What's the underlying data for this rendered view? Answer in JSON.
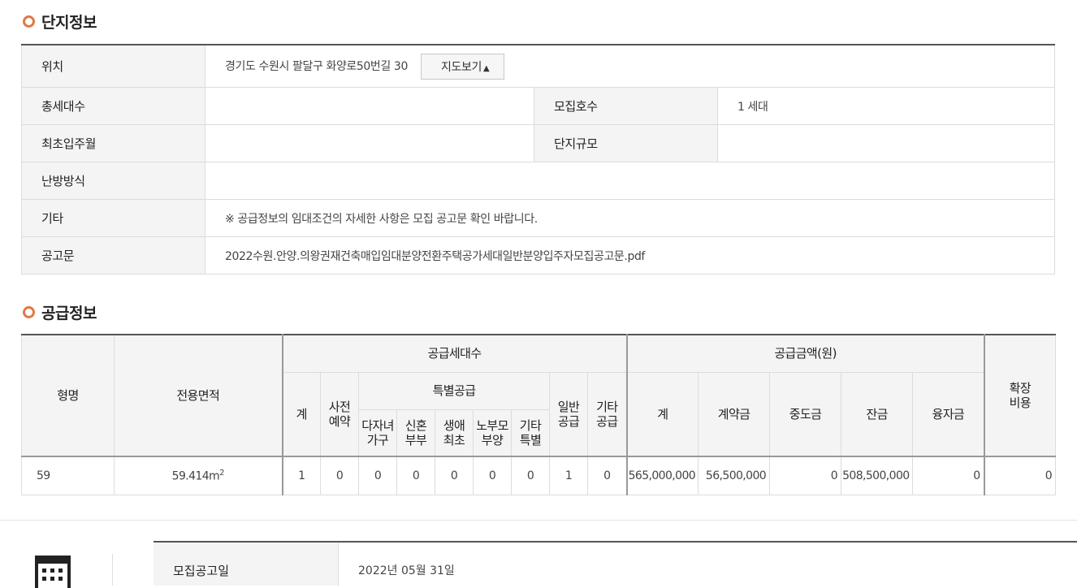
{
  "complex_section": {
    "title": "단지정보",
    "location_label": "위치",
    "location_value": "경기도 수원시 팔달구 화양로50번길 30",
    "map_button": "지도보기",
    "total_households_label": "총세대수",
    "total_households_value": "",
    "recruit_units_label": "모집호수",
    "recruit_units_value": "1 세대",
    "first_movein_label": "최초입주월",
    "first_movein_value": "",
    "complex_scale_label": "단지규모",
    "complex_scale_value": "",
    "heating_label": "난방방식",
    "heating_value": "",
    "other_label": "기타",
    "other_value": "※ 공급정보의 임대조건의 자세한 사항은 모집 공고문 확인 바랍니다.",
    "notice_label": "공고문",
    "notice_file": "2022수원.안양.의왕권재건축매입임대분양전환주택공가세대일반분양입주자모집공고문.pdf"
  },
  "supply_section": {
    "title": "공급정보",
    "headers": {
      "type": "형명",
      "area": "전용면적",
      "supply_units": "공급세대수",
      "total": "계",
      "pre_reservation_1": "사전",
      "pre_reservation_2": "예약",
      "special": "특별공급",
      "multi_child_1": "다자녀",
      "multi_child_2": "가구",
      "newlywed_1": "신혼",
      "newlywed_2": "부부",
      "first_life_1": "생애",
      "first_life_2": "최초",
      "elderly_1": "노부모",
      "elderly_2": "부양",
      "other_special_1": "기타",
      "other_special_2": "특별",
      "general_1": "일반",
      "general_2": "공급",
      "other_supply_1": "기타",
      "other_supply_2": "공급",
      "supply_price": "공급금액(원)",
      "price_total": "계",
      "contract": "계약금",
      "middle": "중도금",
      "balance": "잔금",
      "loan": "융자금",
      "extension_1": "확장",
      "extension_2": "비용"
    },
    "row": {
      "type": "59",
      "area": "59.414m",
      "area_unit_sup": "2",
      "total": "1",
      "pre_reservation": "0",
      "multi_child": "0",
      "newlywed": "0",
      "first_life": "0",
      "elderly": "0",
      "other_special": "0",
      "general": "1",
      "other_supply": "0",
      "price_total": "565,000,000",
      "contract": "56,500,000",
      "middle": "0",
      "balance": "508,500,000",
      "loan": "0",
      "extension": "0"
    }
  },
  "schedule": {
    "icon": "calendar-icon",
    "notice_date_label": "모집공고일",
    "notice_date_value": "2022년 05월 31일"
  }
}
